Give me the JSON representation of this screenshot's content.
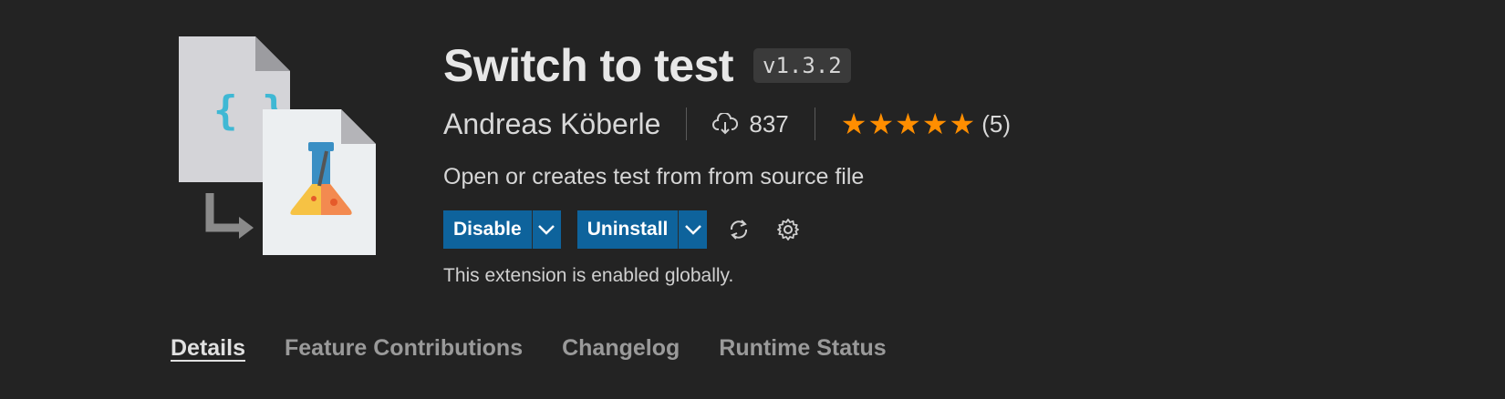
{
  "extension": {
    "name": "Switch to test",
    "version": "v1.3.2",
    "publisher": "Andreas Köberle",
    "installs": "837",
    "rating": 5,
    "rating_count": "(5)",
    "description": "Open or creates test from from source file",
    "status": "This extension is enabled globally."
  },
  "actions": {
    "disable_label": "Disable",
    "uninstall_label": "Uninstall"
  },
  "tabs": [
    {
      "label": "Details",
      "active": true
    },
    {
      "label": "Feature Contributions"
    },
    {
      "label": "Changelog"
    },
    {
      "label": "Runtime Status"
    }
  ],
  "colors": {
    "background": "#232323",
    "button": "#0e639c",
    "star": "#ff8e00",
    "braces": "#3fb8d4"
  },
  "icons": [
    "download-cloud-icon",
    "star-icon",
    "chevron-down-icon",
    "sync-icon",
    "gear-icon",
    "source-file-icon",
    "test-flask-icon",
    "arrow-icon"
  ]
}
